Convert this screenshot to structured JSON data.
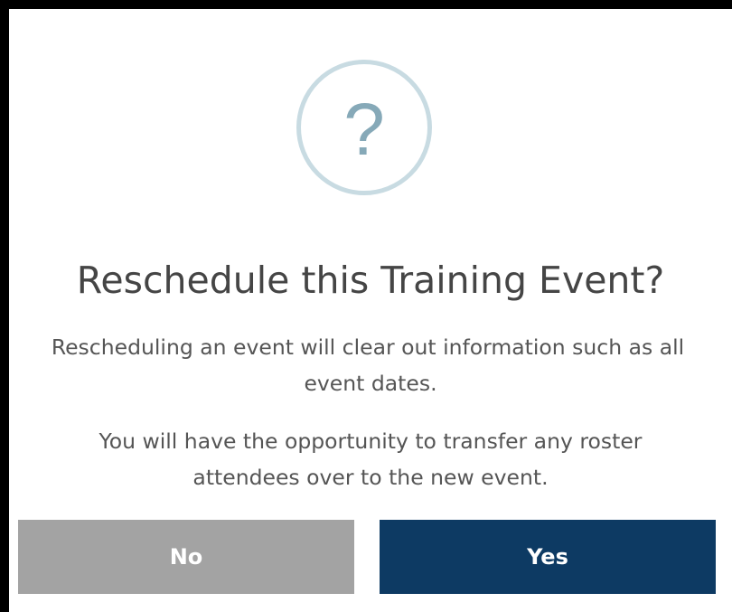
{
  "dialog": {
    "icon": "question-mark-icon",
    "icon_glyph": "?",
    "title": "Reschedule this Training Event?",
    "message_1": {
      "line_1": "Rescheduling an event will clear out information such as all",
      "line_2": "event dates."
    },
    "message_2": {
      "line_1": "You will have the opportunity to transfer any roster",
      "line_2": "attendees over to the new event."
    },
    "buttons": {
      "no_label": "No",
      "yes_label": "Yes"
    }
  },
  "colors": {
    "icon_ring": "#c8dbe2",
    "icon_glyph": "#86a9b8",
    "no_button": "#a3a3a3",
    "yes_button": "#0d3a63"
  }
}
